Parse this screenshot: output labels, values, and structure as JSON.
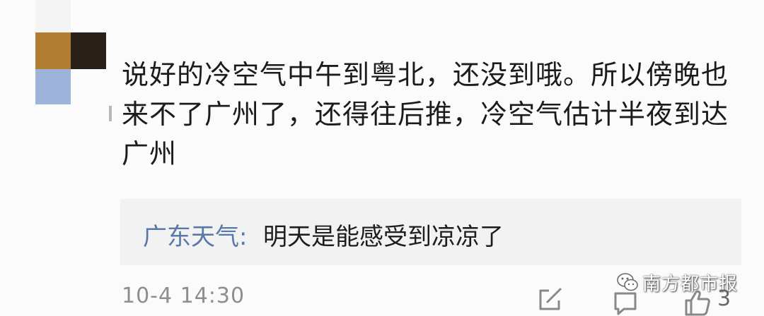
{
  "comment": {
    "body": "说好的冷空气中午到粤北，还没到哦。所以傍晚也来不了广州了，还得往后推，冷空气估计半夜到达广州",
    "timestamp": "10-4 14:30",
    "like_count": "3"
  },
  "reply": {
    "author": "广东天气:",
    "text": "明天是能感受到凉凉了"
  },
  "watermark": {
    "text": "南方都市报"
  },
  "colors": {
    "reply_author": "#5879a8",
    "reply_background": "#f2f2f2",
    "timestamp": "#8e8e8e"
  },
  "icons": [
    "edit-icon",
    "comment-icon",
    "thumbs-up-icon",
    "wechat-logo-icon"
  ]
}
